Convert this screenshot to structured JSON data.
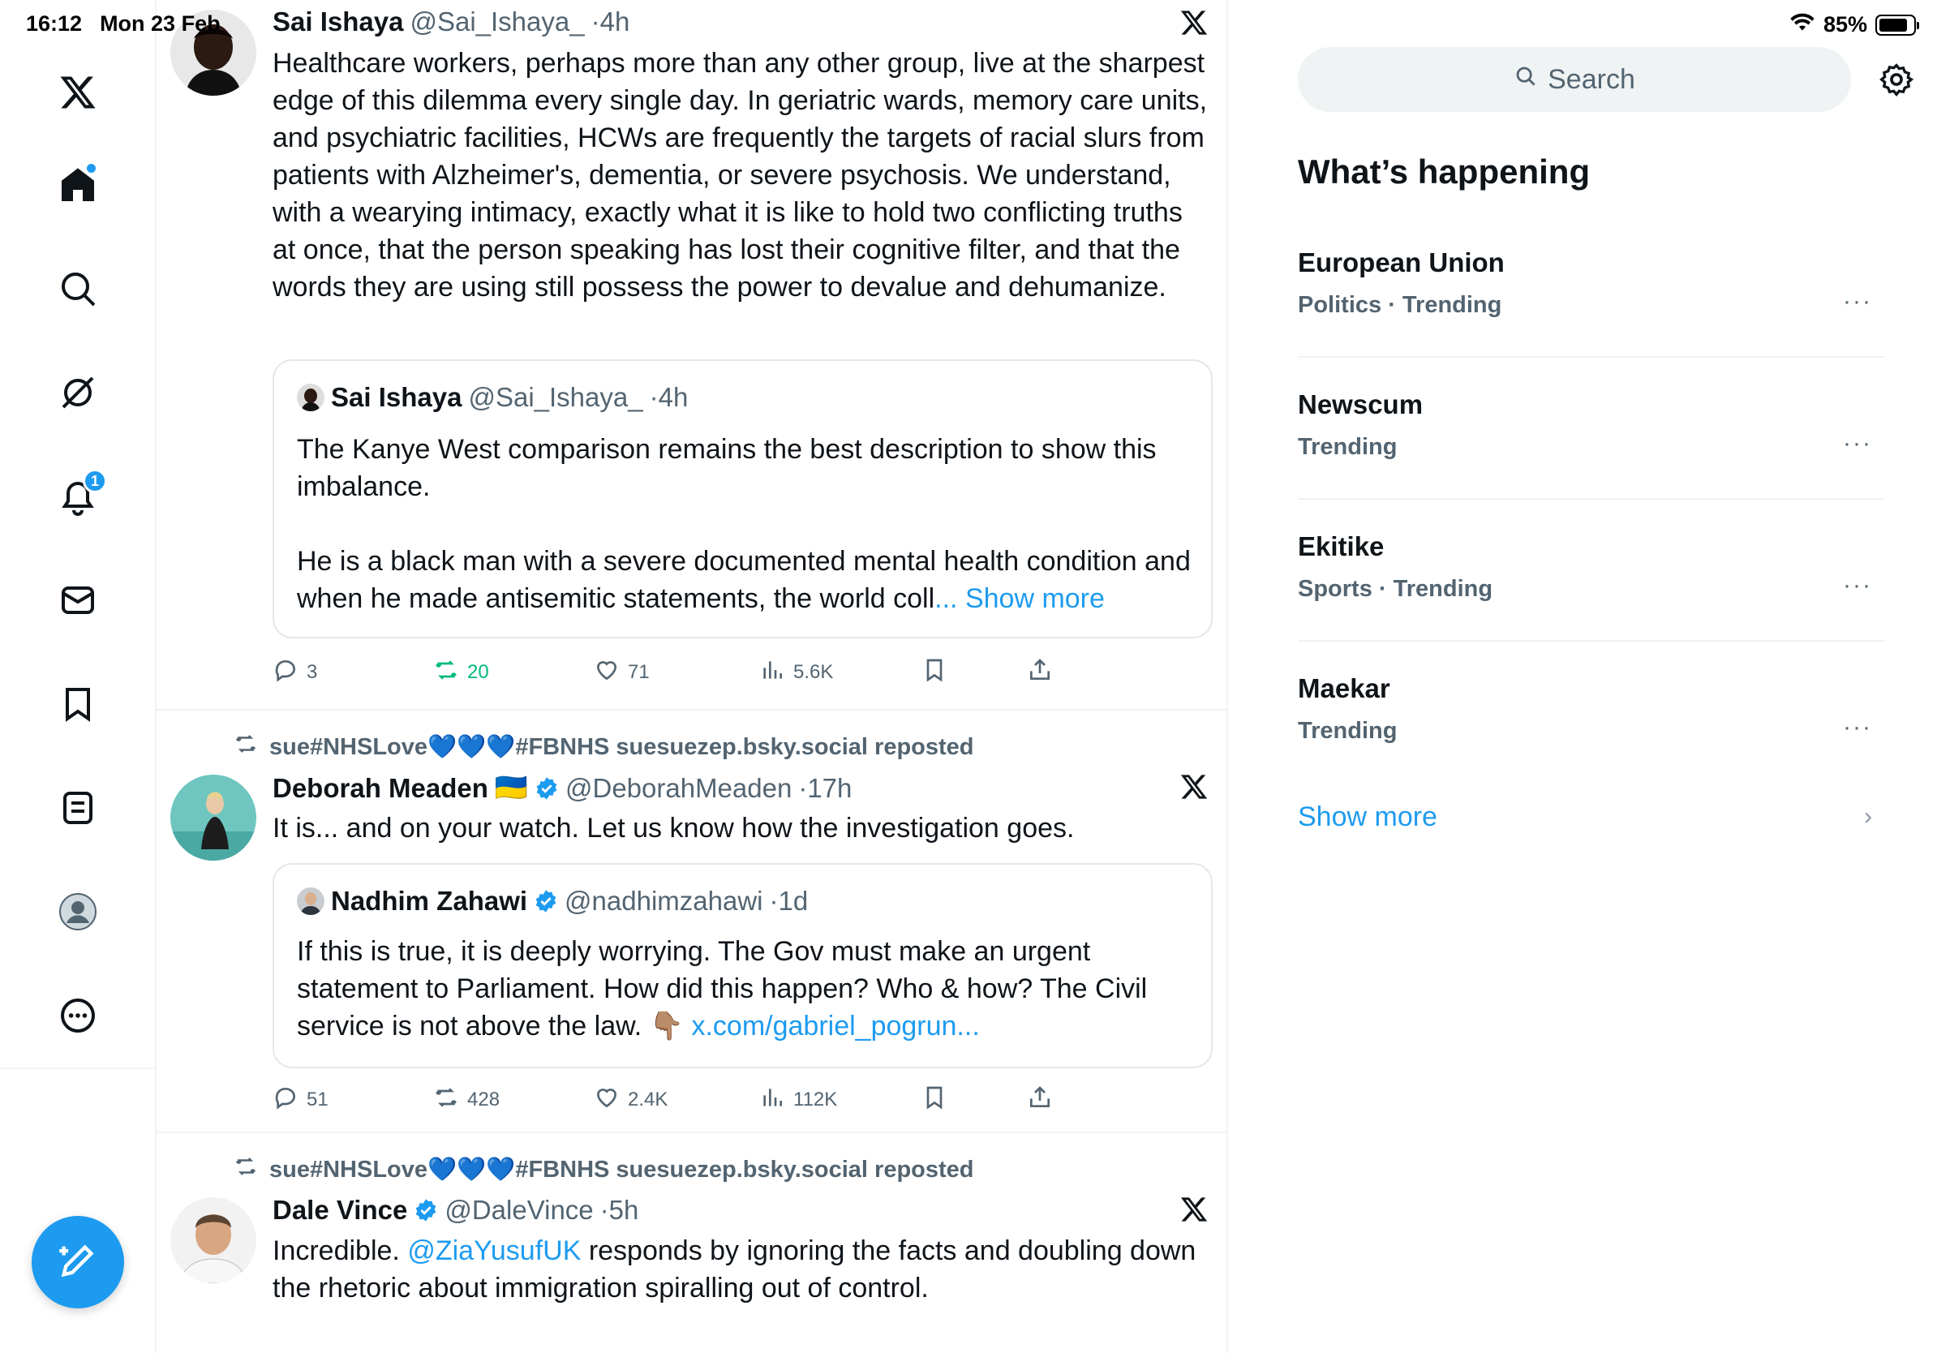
{
  "status_bar": {
    "time": "16:12",
    "date": "Mon 23 Feb",
    "battery": "85%",
    "battery_level": 0.85
  },
  "nav": {
    "items": [
      {
        "icon": "x-logo-icon"
      },
      {
        "icon": "home-icon",
        "unread_dot": true
      },
      {
        "icon": "search-icon"
      },
      {
        "icon": "grok-icon"
      },
      {
        "icon": "bell-icon",
        "badge": "1"
      },
      {
        "icon": "mail-icon"
      },
      {
        "icon": "bookmark-icon"
      },
      {
        "icon": "lists-icon"
      },
      {
        "icon": "profile-icon"
      },
      {
        "icon": "more-circle-icon"
      }
    ],
    "compose_icon": "compose-icon"
  },
  "feed": {
    "tweets": [
      {
        "name": "Sai Ishaya",
        "handle": "@Sai_Ishaya_",
        "time": "4h",
        "text": "Healthcare workers, perhaps more than any other group, live at the sharpest edge of this dilemma every single day. In geriatric wards, memory care units, and psychiatric facilities, HCWs  are frequently the targets of racial slurs from patients with Alzheimer's, dementia, or severe psychosis. We understand, with a wearying intimacy, exactly what it is like to hold two conflicting truths at once, that the person speaking has lost their cognitive filter, and that the words they are using still possess the power to devalue and dehumanize.",
        "quote": {
          "name": "Sai Ishaya",
          "handle": "@Sai_Ishaya_",
          "time": "4h",
          "text1": "The Kanye West comparison remains the best description to show this imbalance.",
          "text2": "He is a black man with a severe documented mental health condition and when he made antisemitic statements, the world coll",
          "ellipsis": "...",
          "show_more": "Show more"
        },
        "stats": {
          "replies": "3",
          "reposts": "20",
          "likes": "71",
          "views": "5.6K"
        }
      },
      {
        "repost_by": "sue#NHSLove💙💙💙#FBNHS suesuezep.bsky.social reposted",
        "name": "Deborah Meaden",
        "flag": "🇺🇦",
        "handle": "@DeborahMeaden",
        "time": "17h",
        "text": "It is... and on your watch. Let us know how the investigation goes.",
        "quote": {
          "name": "Nadhim Zahawi",
          "handle": "@nadhimzahawi",
          "time": "1d",
          "text": "If this is true, it is deeply worrying. The Gov must make an urgent statement to Parliament. How did this happen? Who & how? The Civil service is not above the law.  👇🏽",
          "link": "x.com/gabriel_pogrun..."
        },
        "stats": {
          "replies": "51",
          "reposts": "428",
          "likes": "2.4K",
          "views": "112K"
        }
      },
      {
        "repost_by": "sue#NHSLove💙💙💙#FBNHS suesuezep.bsky.social reposted",
        "name": "Dale Vince",
        "handle": "@DaleVince",
        "time": "5h",
        "text_pre": "Incredible. ",
        "mention": "@ZiaYusufUK",
        "text_post": "  responds by ignoring the facts and doubling down the rhetoric about immigration spiralling out of control."
      }
    ]
  },
  "sidebar": {
    "search_placeholder": "Search",
    "trends_title": "What’s happening",
    "trends": [
      {
        "name": "European Union",
        "meta": "Politics · Trending"
      },
      {
        "name": "Newscum",
        "meta": "Trending"
      },
      {
        "name": "Ekitike",
        "meta": "Sports · Trending"
      },
      {
        "name": "Maekar",
        "meta": "Trending"
      }
    ],
    "more_label": "···",
    "show_more": "Show more",
    "chevron": "›"
  },
  "colors": {
    "accent": "#1d9bf0",
    "repost_green": "#00ba7c",
    "muted": "#536471"
  }
}
